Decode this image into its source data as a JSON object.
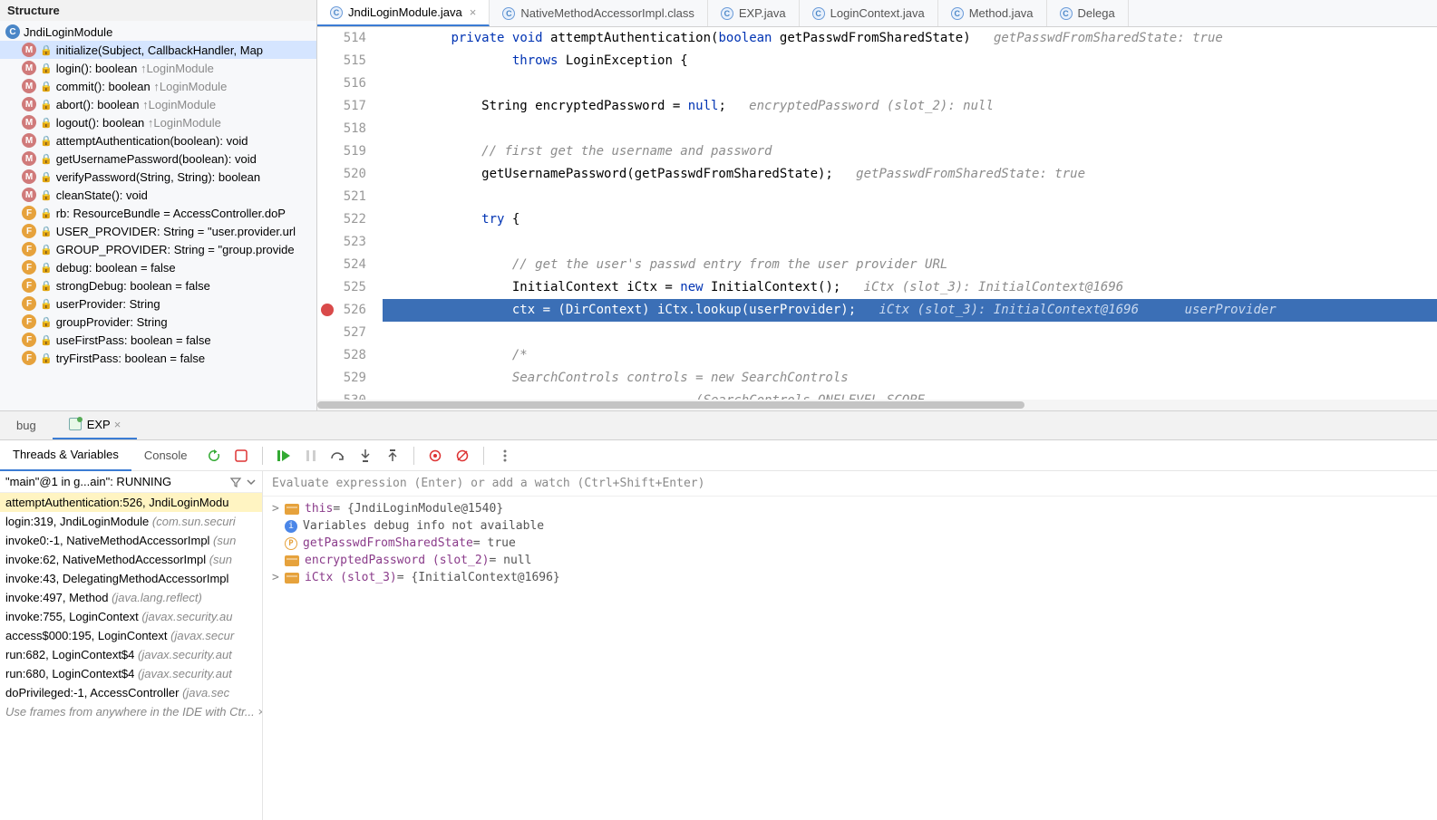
{
  "structure": {
    "title": "Structure",
    "items": [
      {
        "icon": "c",
        "lock": false,
        "text": "JndiLoginModule",
        "inh": "",
        "selected": false,
        "indent": 0
      },
      {
        "icon": "m",
        "lock": true,
        "text": "initialize(Subject, CallbackHandler, Map<Str",
        "inh": "",
        "selected": true,
        "indent": 1
      },
      {
        "icon": "m",
        "lock": true,
        "text": "login(): boolean ",
        "inh": "↑LoginModule",
        "selected": false,
        "indent": 1
      },
      {
        "icon": "m",
        "lock": true,
        "text": "commit(): boolean ",
        "inh": "↑LoginModule",
        "selected": false,
        "indent": 1
      },
      {
        "icon": "m",
        "lock": true,
        "text": "abort(): boolean ",
        "inh": "↑LoginModule",
        "selected": false,
        "indent": 1
      },
      {
        "icon": "m",
        "lock": true,
        "text": "logout(): boolean ",
        "inh": "↑LoginModule",
        "selected": false,
        "indent": 1
      },
      {
        "icon": "m",
        "lock": true,
        "text": "attemptAuthentication(boolean): void",
        "inh": "",
        "selected": false,
        "indent": 1
      },
      {
        "icon": "m",
        "lock": true,
        "text": "getUsernamePassword(boolean): void",
        "inh": "",
        "selected": false,
        "indent": 1
      },
      {
        "icon": "m",
        "lock": true,
        "text": "verifyPassword(String, String): boolean",
        "inh": "",
        "selected": false,
        "indent": 1
      },
      {
        "icon": "m",
        "lock": true,
        "text": "cleanState(): void",
        "inh": "",
        "selected": false,
        "indent": 1
      },
      {
        "icon": "f",
        "lock": true,
        "text": "rb: ResourceBundle = AccessController.doP",
        "inh": "",
        "selected": false,
        "indent": 1
      },
      {
        "icon": "f",
        "lock": true,
        "text": "USER_PROVIDER: String = \"user.provider.url",
        "inh": "",
        "selected": false,
        "indent": 1
      },
      {
        "icon": "f",
        "lock": true,
        "text": "GROUP_PROVIDER: String = \"group.provide",
        "inh": "",
        "selected": false,
        "indent": 1
      },
      {
        "icon": "f",
        "lock": true,
        "text": "debug: boolean = false",
        "inh": "",
        "selected": false,
        "indent": 1
      },
      {
        "icon": "f",
        "lock": true,
        "text": "strongDebug: boolean = false",
        "inh": "",
        "selected": false,
        "indent": 1
      },
      {
        "icon": "f",
        "lock": true,
        "text": "userProvider: String",
        "inh": "",
        "selected": false,
        "indent": 1
      },
      {
        "icon": "f",
        "lock": true,
        "text": "groupProvider: String",
        "inh": "",
        "selected": false,
        "indent": 1
      },
      {
        "icon": "f",
        "lock": true,
        "text": "useFirstPass: boolean = false",
        "inh": "",
        "selected": false,
        "indent": 1
      },
      {
        "icon": "f",
        "lock": true,
        "text": "tryFirstPass: boolean = false",
        "inh": "",
        "selected": false,
        "indent": 1
      }
    ]
  },
  "tabs": [
    {
      "label": "JndiLoginModule.java",
      "active": true,
      "closable": true
    },
    {
      "label": "NativeMethodAccessorImpl.class",
      "active": false,
      "closable": false
    },
    {
      "label": "EXP.java",
      "active": false,
      "closable": false
    },
    {
      "label": "LoginContext.java",
      "active": false,
      "closable": false
    },
    {
      "label": "Method.java",
      "active": false,
      "closable": false
    },
    {
      "label": "Delega",
      "active": false,
      "closable": false
    }
  ],
  "code": {
    "start": 514,
    "lines": [
      {
        "n": 514,
        "html": "        <span class='kw'>private</span> <span class='kw'>void</span> attemptAuthentication(<span class='kw'>boolean</span> getPasswdFromSharedState)   <span class='hint'>getPasswdFromSharedState: true</span>"
      },
      {
        "n": 515,
        "html": "                <span class='kw'>throws</span> LoginException {"
      },
      {
        "n": 516,
        "html": ""
      },
      {
        "n": 517,
        "html": "            String encryptedPassword = <span class='kw'>null</span>;   <span class='hint'>encryptedPassword (slot_2): null</span>"
      },
      {
        "n": 518,
        "html": ""
      },
      {
        "n": 519,
        "html": "            <span class='cm'>// first get the username and password</span>"
      },
      {
        "n": 520,
        "html": "            getUsernamePassword(getPasswdFromSharedState);   <span class='hint'>getPasswdFromSharedState: true</span>"
      },
      {
        "n": 521,
        "html": ""
      },
      {
        "n": 522,
        "html": "            <span class='kw'>try</span> {"
      },
      {
        "n": 523,
        "html": ""
      },
      {
        "n": 524,
        "html": "                <span class='cm'>// get the user's passwd entry from the user provider URL</span>"
      },
      {
        "n": 525,
        "html": "                InitialContext iCtx = <span class='kw'>new</span> InitialContext();   <span class='hint'>iCtx (slot_3): InitialContext@1696</span>"
      },
      {
        "n": 526,
        "hl": true,
        "bp": true,
        "html": "                ctx = (DirContext) iCtx.lookup(userProvider);   <span class='hint'>iCtx (slot_3): InitialContext@1696      userProvider</span>"
      },
      {
        "n": 527,
        "html": ""
      },
      {
        "n": 528,
        "html": "                <span class='cm'>/*</span>"
      },
      {
        "n": 529,
        "html": "                <span class='cm'>SearchControls controls = new SearchControls</span>"
      },
      {
        "n": 530,
        "html": "                <span class='cm'>                        (SearchControls.ONELEVEL_SCOPE,</span>"
      }
    ]
  },
  "debugTabs": {
    "bug": "bug",
    "exp": "EXP"
  },
  "toolbar": {
    "threads": "Threads & Variables",
    "console": "Console"
  },
  "thread": {
    "name": "\"main\"@1 in g...ain\": RUNNING"
  },
  "frames": [
    {
      "text": "attemptAuthentication:526, JndiLoginModu",
      "pkg": "",
      "sel": true
    },
    {
      "text": "login:319, JndiLoginModule ",
      "pkg": "(com.sun.securi"
    },
    {
      "text": "invoke0:-1, NativeMethodAccessorImpl ",
      "pkg": "(sun"
    },
    {
      "text": "invoke:62, NativeMethodAccessorImpl ",
      "pkg": "(sun"
    },
    {
      "text": "invoke:43, DelegatingMethodAccessorImpl",
      "pkg": ""
    },
    {
      "text": "invoke:497, Method ",
      "pkg": "(java.lang.reflect)"
    },
    {
      "text": "invoke:755, LoginContext ",
      "pkg": "(javax.security.au"
    },
    {
      "text": "access$000:195, LoginContext ",
      "pkg": "(javax.secur"
    },
    {
      "text": "run:682, LoginContext$4 ",
      "pkg": "(javax.security.aut"
    },
    {
      "text": "run:680, LoginContext$4 ",
      "pkg": "(javax.security.aut"
    },
    {
      "text": "doPrivileged:-1, AccessController ",
      "pkg": "(java.sec"
    }
  ],
  "framesFooter": "Use frames from anywhere in the IDE with Ctr...",
  "eval": "Evaluate expression (Enter) or add a watch (Ctrl+Shift+Enter)",
  "vars": [
    {
      "type": "obj",
      "arrow": ">",
      "name": "this",
      "sep": " = ",
      "val": "{JndiLoginModule@1540}"
    },
    {
      "type": "info",
      "arrow": "",
      "name": "",
      "sep": "",
      "val": "Variables debug info not available"
    },
    {
      "type": "p",
      "arrow": "",
      "name": "getPasswdFromSharedState",
      "sep": " = ",
      "val": "true"
    },
    {
      "type": "obj",
      "arrow": "",
      "name": "encryptedPassword (slot_2)",
      "sep": " = ",
      "val": "null"
    },
    {
      "type": "obj",
      "arrow": ">",
      "name": "iCtx (slot_3)",
      "sep": " = ",
      "val": "{InitialContext@1696}"
    }
  ]
}
